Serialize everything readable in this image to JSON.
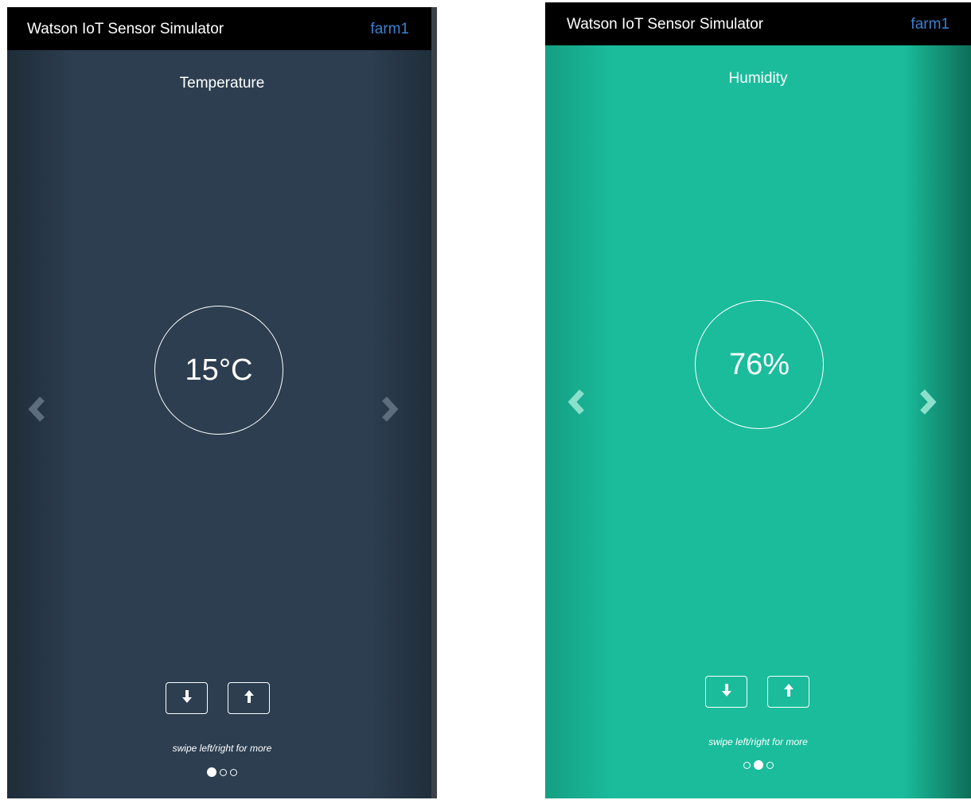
{
  "screens": [
    {
      "app_title": "Watson IoT Sensor Simulator",
      "device": "farm1",
      "sensor_label": "Temperature",
      "value": "15°C",
      "swipe_hint": "swipe left/right for more",
      "active_page": 1,
      "page_count": 3,
      "background": "#2c3e50"
    },
    {
      "app_title": "Watson IoT Sensor Simulator",
      "device": "farm1",
      "sensor_label": "Humidity",
      "value": "76%",
      "swipe_hint": "swipe left/right for more",
      "active_page": 2,
      "page_count": 3,
      "background": "#1abc9c"
    }
  ],
  "icons": {
    "prev": "chevron-left-icon",
    "next": "chevron-right-icon",
    "down": "arrow-down-icon",
    "up": "arrow-up-icon"
  },
  "colors": {
    "header": "#000000",
    "device_link": "#3a80d2",
    "text": "#ffffff"
  }
}
